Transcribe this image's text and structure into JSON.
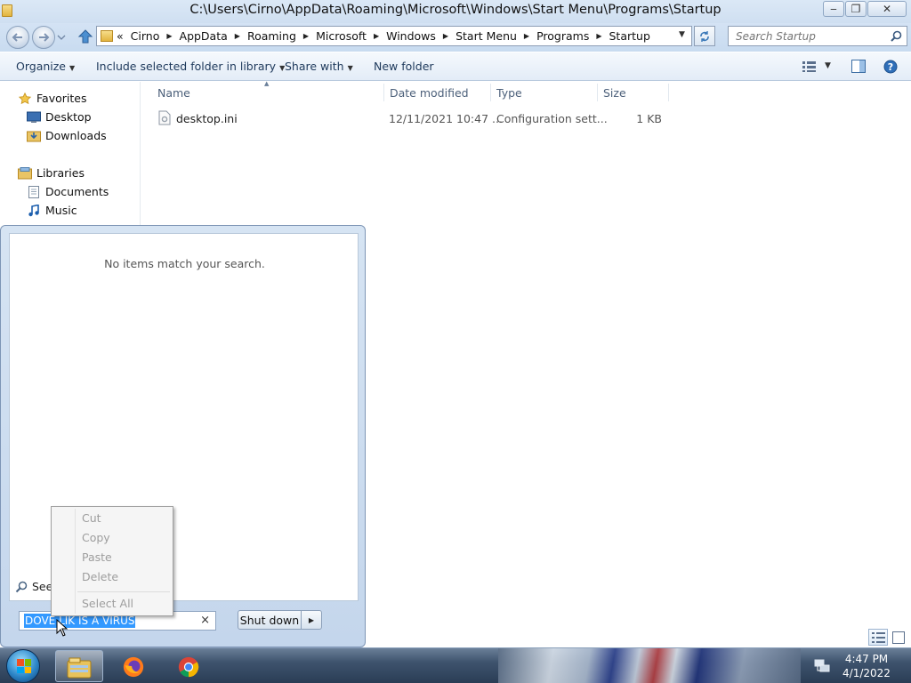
{
  "window": {
    "title": "C:\\Users\\Cirno\\AppData\\Roaming\\Microsoft\\Windows\\Start Menu\\Programs\\Startup",
    "minimize_glyph": "‒",
    "restore_glyph": "❐",
    "close_glyph": "✕"
  },
  "address": {
    "overflow_glyph": "«",
    "crumbs": [
      "Cirno",
      "AppData",
      "Roaming",
      "Microsoft",
      "Windows",
      "Start Menu",
      "Programs",
      "Startup"
    ]
  },
  "search": {
    "placeholder": "Search Startup"
  },
  "toolbar": {
    "organize": "Organize",
    "include_library": "Include selected folder in library",
    "share_with": "Share with",
    "new_folder": "New folder"
  },
  "nav": {
    "favorites": "Favorites",
    "desktop": "Desktop",
    "downloads": "Downloads",
    "libraries": "Libraries",
    "documents": "Documents",
    "music": "Music"
  },
  "files": {
    "columns": {
      "name": "Name",
      "date": "Date modified",
      "type": "Type",
      "size": "Size"
    },
    "rows": [
      {
        "name": "desktop.ini",
        "date": "12/11/2021 10:47 ...",
        "type": "Configuration sett...",
        "size": "1 KB"
      }
    ]
  },
  "start_menu": {
    "no_items": "No items match your search.",
    "see_more": "See more results",
    "search_value": "DOVE LIK IS A VIRUS",
    "clear_glyph": "×",
    "shutdown": "Shut down"
  },
  "context_menu": {
    "items": [
      "Cut",
      "Copy",
      "Paste",
      "Delete",
      "Select All"
    ]
  },
  "taskbar": {
    "time": "4:47 PM",
    "date": "4/1/2022"
  },
  "colors": {
    "accent": "#1e395b",
    "selection": "#3399ff",
    "taskbar": "#2a3d55"
  }
}
